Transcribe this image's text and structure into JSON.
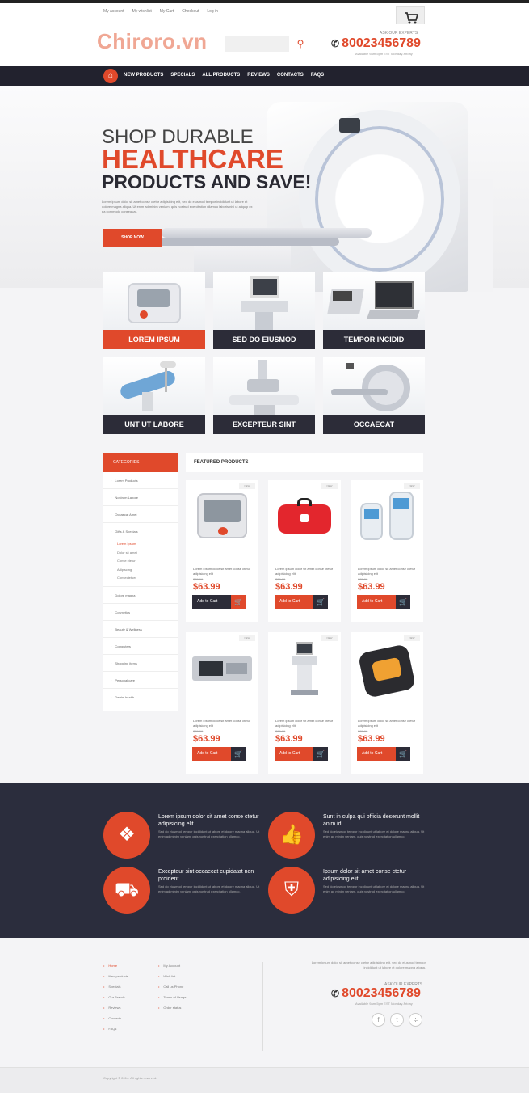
{
  "topbar": {
    "links": [
      "My account",
      "My wishlist",
      "My Cart",
      "Checkout",
      "Log in"
    ]
  },
  "header": {
    "logo": "Chiroro.vn",
    "search_icon": "search-icon",
    "hotline_label": "ASK OUR EXPERTS",
    "phone": "80023456789",
    "hours": "Available 9am-5pm EST Monday-Friday"
  },
  "nav": {
    "home_icon": "home-icon",
    "items": [
      "NEW PRODUCTS",
      "SPECIALS",
      "ALL PRODUCTS",
      "REVIEWS",
      "CONTACTS",
      "FAQS"
    ]
  },
  "hero": {
    "line1": "SHOP DURABLE",
    "line2": "HEALTHCARE",
    "line3": "PRODUCTS AND SAVE!",
    "text": "Lorem ipsum dolor sit amet conse ctetur adipisicing elit, sed do eiusmod tempor incididunt ut labore et dolore magna aliqua. Ut enim ad minim veniam, quis nostrud exercitation ullamco laboris nisi ut aliquip ex ea commodo consequat.",
    "button": "SHOP NOW"
  },
  "categories": [
    {
      "label": "LOREM IPSUM"
    },
    {
      "label": "SED DO EIUSMOD"
    },
    {
      "label": "TEMPOR INCIDID"
    },
    {
      "label": "UNT UT LABORE"
    },
    {
      "label": "EXCEPTEUR SINT"
    },
    {
      "label": "OCCAECAT"
    }
  ],
  "sidebar": {
    "heading": "CATEGORIES",
    "items": [
      "Lorem Products",
      "Nostrum Labore",
      "Occaecat Amet",
      "Gifts & Specials"
    ],
    "subitems": [
      "Lorem Ipsum",
      "Dolor sit amet",
      "Conse ctetur",
      "Adipiscing",
      "Consectetuer"
    ],
    "items_after": [
      "Dolore magna",
      "Cosmetics",
      "Beauty & Wellness",
      "Computers",
      "Shopping items",
      "Personal care",
      "Dental health"
    ]
  },
  "featured": {
    "heading": "FEATURED PRODUCTS",
    "products": [
      {
        "tag": "NEW",
        "desc": "Lorem ipsum dolor sit amet conse ctetur adipisicing elit",
        "old": "$79.99",
        "price": "$63.99",
        "button": "Add to Cart"
      },
      {
        "tag": "NEW",
        "desc": "Lorem ipsum dolor sit amet conse ctetur adipisicing elit",
        "old": "$79.99",
        "price": "$63.99",
        "button": "Add to Cart"
      },
      {
        "tag": "NEW",
        "desc": "Lorem ipsum dolor sit amet conse ctetur adipisicing elit",
        "old": "$79.99",
        "price": "$63.99",
        "button": "Add to Cart"
      },
      {
        "tag": "NEW",
        "desc": "Lorem ipsum dolor sit amet conse ctetur adipisicing elit",
        "old": "$79.99",
        "price": "$63.99",
        "button": "Add to Cart"
      },
      {
        "tag": "NEW",
        "desc": "Lorem ipsum dolor sit amet conse ctetur adipisicing elit",
        "old": "$79.99",
        "price": "$63.99",
        "button": "Add to Cart"
      },
      {
        "tag": "NEW",
        "desc": "Lorem ipsum dolor sit amet conse ctetur adipisicing elit",
        "old": "$79.99",
        "price": "$63.99",
        "button": "Add to Cart"
      }
    ]
  },
  "features": [
    {
      "icon": "dropbox-icon",
      "title": "Lorem ipsum dolor sit amet conse ctetur adipisicing elit",
      "text": "Sed do eiusmod tempor incididunt ut labore et dolore magna aliqua. Ut enim ad minim veniam, quis nostrud exercitation ullamco."
    },
    {
      "icon": "thumbs-up-icon",
      "title": "Sunt in culpa qui officia deserunt mollit anim id",
      "text": "Sed do eiusmod tempor incididunt ut labore et dolore magna aliqua. Ut enim ad minim veniam, quis nostrud exercitation ullamco."
    },
    {
      "icon": "truck-icon",
      "title": "Excepteur sint occaecat cupidatat non proident",
      "text": "Sed do eiusmod tempor incididunt ut labore et dolore magna aliqua. Ut enim ad minim veniam, quis nostrud exercitation ullamco."
    },
    {
      "icon": "shield-icon",
      "title": "Ipsum dolor sit amet conse ctetur adipisicing elit",
      "text": "Sed do eiusmod tempor incididunt ut labore et dolore magna aliqua. Ut enim ad minim veniam, quis nostrud exercitation ullamco."
    }
  ],
  "footer": {
    "col1": [
      "Home",
      "New products",
      "Specials",
      "Our Brands",
      "Reviews",
      "Contacts",
      "FAQs"
    ],
    "col2": [
      "My Account",
      "Wish list",
      "Call us Phone",
      "Terms of Usage",
      "Order status"
    ],
    "text": "Lorem ipsum dolor sit amet conse ctetur adipisicing elit, sed do eiusmod tempor incididunt ut labore et dolore magna aliqua.",
    "hotline_label": "ASK OUR EXPERTS",
    "phone": "80023456789",
    "hours": "Available 9am-5pm EST Monday-Friday",
    "social": [
      "f",
      "t",
      "rss"
    ],
    "copyright": "Copyright © 2014. All rights reserved."
  },
  "colors": {
    "accent": "#e0492b",
    "dark": "#2c2c38",
    "band": "#2b2d3d"
  }
}
